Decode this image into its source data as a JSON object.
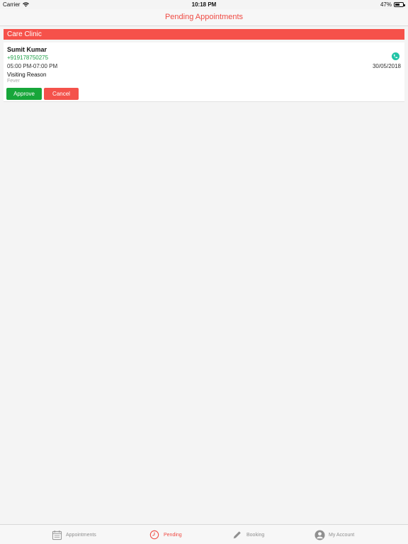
{
  "status_bar": {
    "carrier": "Carrier",
    "time": "10:18 PM",
    "battery": "47%",
    "battery_level": 0.47
  },
  "nav": {
    "title": "Pending Appointments"
  },
  "clinic": {
    "name": "Care Clinic"
  },
  "appointment": {
    "patient_name": "Sumit Kumar",
    "phone": "+919178750275",
    "time_slot": "05:00 PM-07:00 PM",
    "date": "30/05/2018",
    "visit_reason_label": "Visiting Reason",
    "visit_reason": "Fever",
    "approve_label": "Approve",
    "cancel_label": "Cancel"
  },
  "tabs": [
    {
      "label": "Appointments",
      "icon": "calendar-icon",
      "active": false
    },
    {
      "label": "Pending",
      "icon": "clock-icon",
      "active": true
    },
    {
      "label": "Booking",
      "icon": "pencil-icon",
      "active": false
    },
    {
      "label": "My Account",
      "icon": "user-icon",
      "active": false
    }
  ],
  "colors": {
    "accent": "#ef4b44",
    "clinic_header": "#f6514a",
    "approve": "#17a63a",
    "phone": "#1ea046",
    "call": "#21c4a6"
  }
}
